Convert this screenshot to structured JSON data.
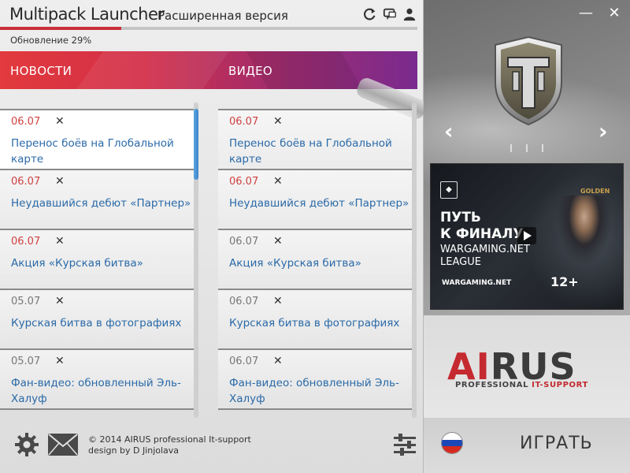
{
  "app": {
    "title": "Multipack Launcher",
    "subtitle": "Расширенная версия"
  },
  "update": {
    "label": "Обновление 29%",
    "progress_percent": 29
  },
  "tabs": {
    "news": "НОВОСТИ",
    "video": "ВИДЕО"
  },
  "news": [
    {
      "date": "06.07",
      "title": "Перенос боёв на Глобальной карте",
      "fresh": true
    },
    {
      "date": "06.07",
      "title": "Неудавшийся дебют «Партнер»",
      "fresh": true
    },
    {
      "date": "06.07",
      "title": "Акция «Курская битва»",
      "fresh": true
    },
    {
      "date": "05.07",
      "title": "Курская битва в фотографиях",
      "fresh": false
    },
    {
      "date": "05.07",
      "title": "Фан-видео: обновленный Эль-Халуф",
      "fresh": false
    }
  ],
  "videos": [
    {
      "date": "06.07",
      "title": "Перенос боёв на Глобальной карте",
      "fresh": true
    },
    {
      "date": "06.07",
      "title": "Неудавшийся дебют «Партнер»",
      "fresh": true
    },
    {
      "date": "06.07",
      "title": "Акция «Курская битва»",
      "fresh": false
    },
    {
      "date": "06.07",
      "title": "Курская битва в фотографиях",
      "fresh": false
    },
    {
      "date": "06.07",
      "title": "Фан-видео: обновленный Эль-Халуф",
      "fresh": false
    }
  ],
  "close_glyph": "✕",
  "footer": {
    "copyright": "© 2014 AIRUS professional It-support",
    "design": "design by D Jinjolava"
  },
  "featured_video": {
    "line1": "ПУТЬ",
    "line2": "К ФИНАЛУ",
    "line3": "WARGAMING.NET",
    "line4": "LEAGUE",
    "brand": "WARGAMING.NET",
    "age": "12+",
    "golden": "GOLDEN"
  },
  "brand_logo": {
    "part1": "AI",
    "part2": "RUS",
    "tagline_a": "PROFESSIONAL ",
    "tagline_b": "IT-SUPPORT"
  },
  "play_button": "ИГРАТЬ",
  "window_controls": {
    "minimize": "—",
    "close": "✕"
  },
  "nav": {
    "prev": "‹",
    "next": "›"
  },
  "icons": [
    "refresh-icon",
    "chat-icon",
    "user-icon",
    "gear-icon",
    "mail-icon",
    "sliders-icon",
    "flag-icon"
  ],
  "colors": {
    "accent_red": "#c8303a",
    "link_blue": "#2a6aa8",
    "fresh_date": "#d04040",
    "old_date": "#777777"
  }
}
